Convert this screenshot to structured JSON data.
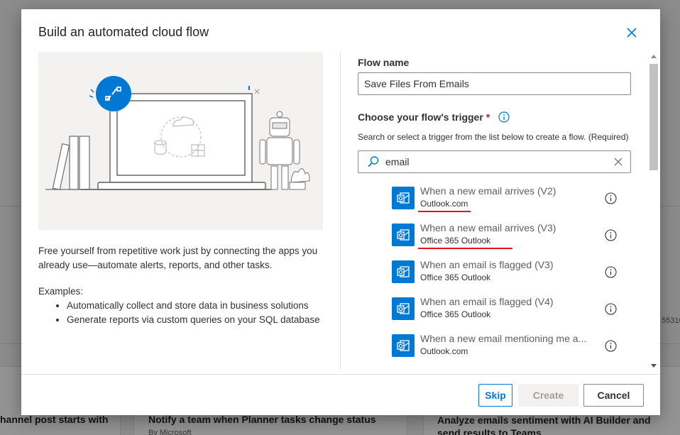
{
  "background": {
    "card_titles": [
      "hannel post starts with",
      "Notify a team when Planner tasks change status",
      "Analyze emails sentiment with AI Builder and send results to Teams"
    ],
    "card_subtitles": [
      "By Microsoft"
    ],
    "side_number": "55310"
  },
  "dialog": {
    "title": "Build an automated cloud flow",
    "description": "Free yourself from repetitive work just by connecting the apps you already use—automate alerts, reports, and other tasks.",
    "examples_label": "Examples:",
    "examples": [
      "Automatically collect and store data in business solutions",
      "Generate reports via custom queries on your SQL database"
    ],
    "flow_name_label": "Flow name",
    "flow_name_value": "Save Files From Emails",
    "trigger_label": "Choose your flow's trigger",
    "required_mark": "*",
    "helper_text": "Search or select a trigger from the list below to create a flow. (Required)",
    "search_value": "email",
    "triggers": [
      {
        "name": "When a new email arrives (V2)",
        "connector": "Outlook.com",
        "underlined": true
      },
      {
        "name": "When a new email arrives (V3)",
        "connector": "Office 365 Outlook",
        "underlined": true
      },
      {
        "name": "When an email is flagged (V3)",
        "connector": "Office 365 Outlook",
        "underlined": false
      },
      {
        "name": "When an email is flagged (V4)",
        "connector": "Office 365 Outlook",
        "underlined": false
      },
      {
        "name": "When a new email mentioning me a...",
        "connector": "Outlook.com",
        "underlined": false
      }
    ],
    "buttons": {
      "skip": "Skip",
      "create": "Create",
      "cancel": "Cancel"
    }
  },
  "colors": {
    "accent": "#0078d4",
    "underline": "#e81123",
    "required": "#a4262c"
  }
}
